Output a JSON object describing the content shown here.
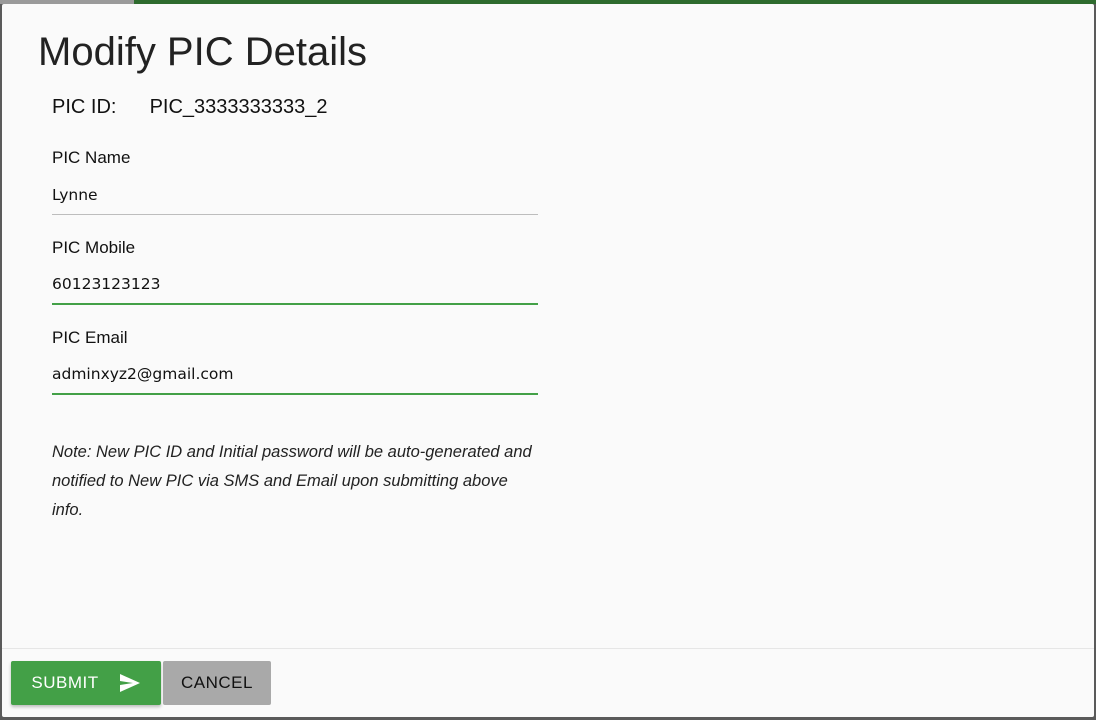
{
  "dialog": {
    "title": "Modify PIC Details",
    "pic_id_label": "PIC ID:",
    "pic_id_value": "PIC_3333333333_2",
    "fields": {
      "name": {
        "label": "PIC Name",
        "value": "Lynne"
      },
      "mobile": {
        "label": "PIC Mobile",
        "value": "60123123123"
      },
      "email": {
        "label": "PIC Email",
        "value": "adminxyz2@gmail.com"
      }
    },
    "note": "Note: New PIC ID and Initial password will be auto-generated and notified to New PIC via SMS and Email upon submitting above info.",
    "buttons": {
      "submit_label": "SUBMIT",
      "submit_icon": "send-icon",
      "cancel_label": "CANCEL"
    }
  },
  "colors": {
    "accent": "#43a047",
    "cancel_bg": "#a9a9a9",
    "dialog_bg": "#fafafa"
  }
}
